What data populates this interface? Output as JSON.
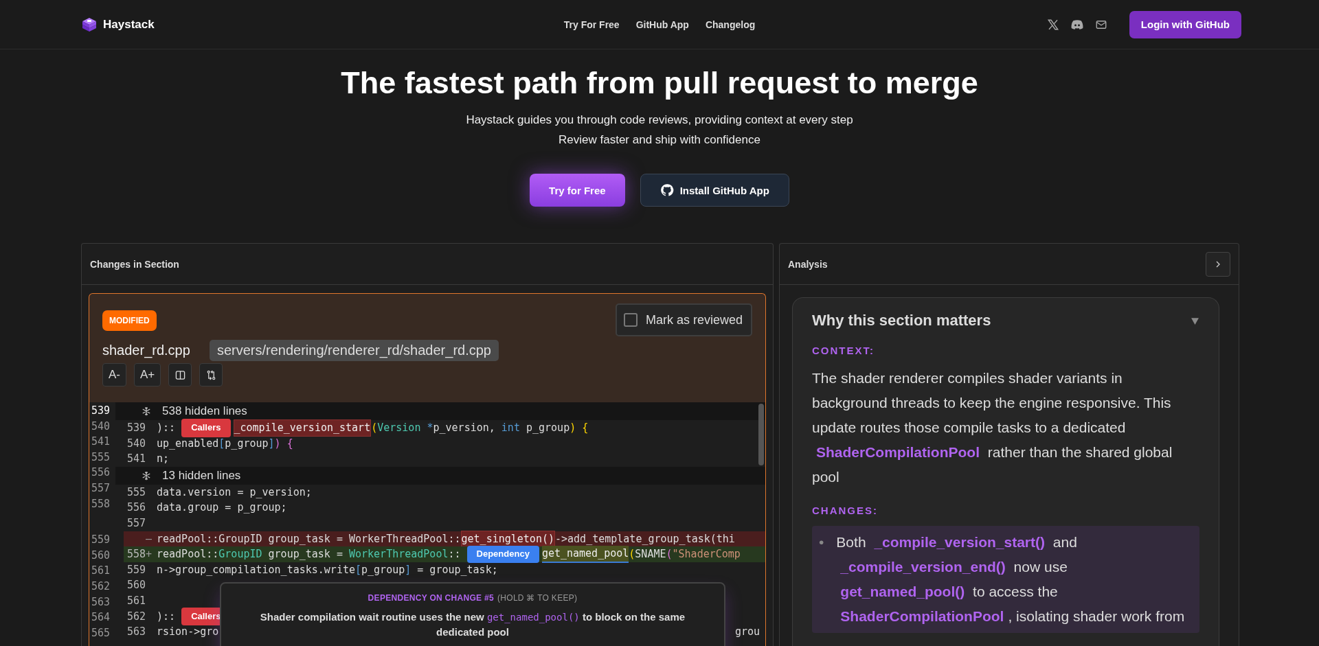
{
  "nav": {
    "brand": "Haystack",
    "links": [
      "Try For Free",
      "GitHub App",
      "Changelog"
    ],
    "login": "Login with GitHub"
  },
  "hero": {
    "title": "The fastest path from pull request to merge",
    "subtitle_lines": [
      "Haystack guides you through code reviews, providing context at every step",
      "Review faster and ship with confidence"
    ],
    "primary_button": "Try for Free",
    "secondary_button": "Install GitHub App"
  },
  "changes_panel": {
    "title": "Changes in Section",
    "file": {
      "status": "MODIFIED",
      "name": "shader_rd.cpp",
      "path": "servers/rendering/renderer_rd/shader_rd.cpp",
      "reviewed": false,
      "reviewed_label": "Mark as reviewed",
      "font_buttons": [
        "A-",
        "A+"
      ]
    },
    "outer_gutter": [
      {
        "number": "539",
        "current": true,
        "gap_after": false
      },
      {
        "number": "540",
        "current": false,
        "gap_after": false
      },
      {
        "number": "541",
        "current": false,
        "gap_after": false
      },
      {
        "number": "555",
        "current": false,
        "gap_after": false
      },
      {
        "number": "556",
        "current": false,
        "gap_after": false
      },
      {
        "number": "557",
        "current": false,
        "gap_after": false
      },
      {
        "number": "558",
        "current": false,
        "gap_after": true
      },
      {
        "number": "559",
        "current": false,
        "gap_after": false
      },
      {
        "number": "560",
        "current": false,
        "gap_after": false
      },
      {
        "number": "561",
        "current": false,
        "gap_after": false
      },
      {
        "number": "562",
        "current": false,
        "gap_after": false
      },
      {
        "number": "563",
        "current": false,
        "gap_after": false
      },
      {
        "number": "564",
        "current": false,
        "gap_after": false
      },
      {
        "number": "565",
        "current": false,
        "gap_after": false
      }
    ],
    "rows": [
      {
        "kind": "hidden",
        "text": "538 hidden lines"
      },
      {
        "kind": "line",
        "number": "539",
        "tokens": [
          {
            "kind": "plain",
            "text": "):: "
          },
          {
            "kind": "callers",
            "text": "Callers"
          },
          {
            "kind": "hl-removed",
            "text": "_compile_version_start"
          },
          {
            "kind": "bracket",
            "text": "("
          },
          {
            "kind": "type",
            "text": "Version "
          },
          {
            "kind": "kw",
            "text": "*"
          },
          {
            "kind": "plain",
            "text": "p_version, "
          },
          {
            "kind": "kw",
            "text": "int"
          },
          {
            "kind": "plain",
            "text": " p_group"
          },
          {
            "kind": "bracket",
            "text": ") {"
          }
        ]
      },
      {
        "kind": "line",
        "number": "540",
        "tokens": [
          {
            "kind": "plain",
            "text": "up_enabled"
          },
          {
            "kind": "kw",
            "text": "["
          },
          {
            "kind": "plain",
            "text": "p_group"
          },
          {
            "kind": "kw",
            "text": "]"
          },
          {
            "kind": "pink",
            "text": ") {"
          }
        ]
      },
      {
        "kind": "line",
        "number": "541",
        "tokens": [
          {
            "kind": "plain",
            "text": "n;"
          }
        ]
      },
      {
        "kind": "hidden",
        "text": "13 hidden lines"
      },
      {
        "kind": "line",
        "number": "555",
        "tokens": [
          {
            "kind": "plain",
            "text": "data.version = p_version;"
          }
        ]
      },
      {
        "kind": "line",
        "number": "556",
        "tokens": [
          {
            "kind": "plain",
            "text": "data.group = p_group;"
          }
        ]
      },
      {
        "kind": "line",
        "number": "557"
      },
      {
        "kind": "removed",
        "marker": "—",
        "tokens": [
          {
            "kind": "plain",
            "text": "readPool::GroupID group_task = WorkerThreadPool::"
          },
          {
            "kind": "hl-removed",
            "text": "get_singleton()"
          },
          {
            "kind": "plain",
            "text": "->add_template_group_task(thi"
          }
        ]
      },
      {
        "kind": "added",
        "number": "558",
        "marker": "+",
        "tokens": [
          {
            "kind": "plain",
            "text": "readPool::"
          },
          {
            "kind": "type",
            "text": "GroupID"
          },
          {
            "kind": "plain",
            "text": " group_task = "
          },
          {
            "kind": "type",
            "text": "WorkerThreadPool"
          },
          {
            "kind": "plain",
            "text": ":: "
          },
          {
            "kind": "dependency",
            "text": "Dependency"
          },
          {
            "kind": "hl-added",
            "text": "get_named_pool"
          },
          {
            "kind": "bracket",
            "text": "("
          },
          {
            "kind": "plain",
            "text": "SNAME"
          },
          {
            "kind": "pink",
            "text": "("
          },
          {
            "kind": "string",
            "text": "\"ShaderComp"
          }
        ]
      },
      {
        "kind": "line",
        "number": "559",
        "tokens": [
          {
            "kind": "plain",
            "text": "n->group_compilation_tasks.write"
          },
          {
            "kind": "kw",
            "text": "["
          },
          {
            "kind": "plain",
            "text": "p_group"
          },
          {
            "kind": "kw",
            "text": "]"
          },
          {
            "kind": "plain",
            "text": " = group_task;"
          }
        ]
      },
      {
        "kind": "line",
        "number": "560"
      },
      {
        "kind": "line",
        "number": "561"
      },
      {
        "kind": "line",
        "number": "562",
        "tokens": [
          {
            "kind": "plain",
            "text": "):: "
          },
          {
            "kind": "callers",
            "text": "Callers"
          }
        ]
      },
      {
        "kind": "line",
        "number": "563",
        "tokens": [
          {
            "kind": "plain",
            "text": "rsion->gro"
          }
        ],
        "tail": "grou"
      }
    ],
    "tooltip": {
      "title": "DEPENDENCY ON CHANGE #5",
      "hint": "(HOLD ⌘ TO KEEP)",
      "body": [
        {
          "kind": "text",
          "text": "Shader compilation wait routine uses the new "
        },
        {
          "kind": "code",
          "text": "get_named_pool()"
        },
        {
          "kind": "text",
          "text": " to block on the same dedicated pool"
        }
      ]
    }
  },
  "analysis_panel": {
    "title": "Analysis",
    "card": {
      "title": "Why this section matters",
      "expanded": true,
      "context_label": "CONTEXT:",
      "context": [
        {
          "kind": "text",
          "text": "The shader renderer compiles shader variants in background threads to keep the engine responsive. This update routes those compile tasks to a dedicated "
        },
        {
          "kind": "code",
          "text": "ShaderCompilationPool"
        },
        {
          "kind": "text",
          "text": " rather than the shared global pool"
        }
      ],
      "changes_label": "CHANGES:",
      "changes": [
        {
          "bullet": "•",
          "parts": [
            {
              "kind": "text",
              "text": "Both "
            },
            {
              "kind": "code",
              "text": "_compile_version_start()"
            },
            {
              "kind": "text",
              "text": " and "
            },
            {
              "kind": "code",
              "text": "_compile_version_end()"
            },
            {
              "kind": "text",
              "text": " now use "
            },
            {
              "kind": "code",
              "text": "get_named_pool()"
            },
            {
              "kind": "text",
              "text": " to access the "
            },
            {
              "kind": "code",
              "text": "ShaderCompilationPool"
            },
            {
              "kind": "text",
              "text": ", isolating shader work from"
            }
          ]
        }
      ]
    }
  }
}
